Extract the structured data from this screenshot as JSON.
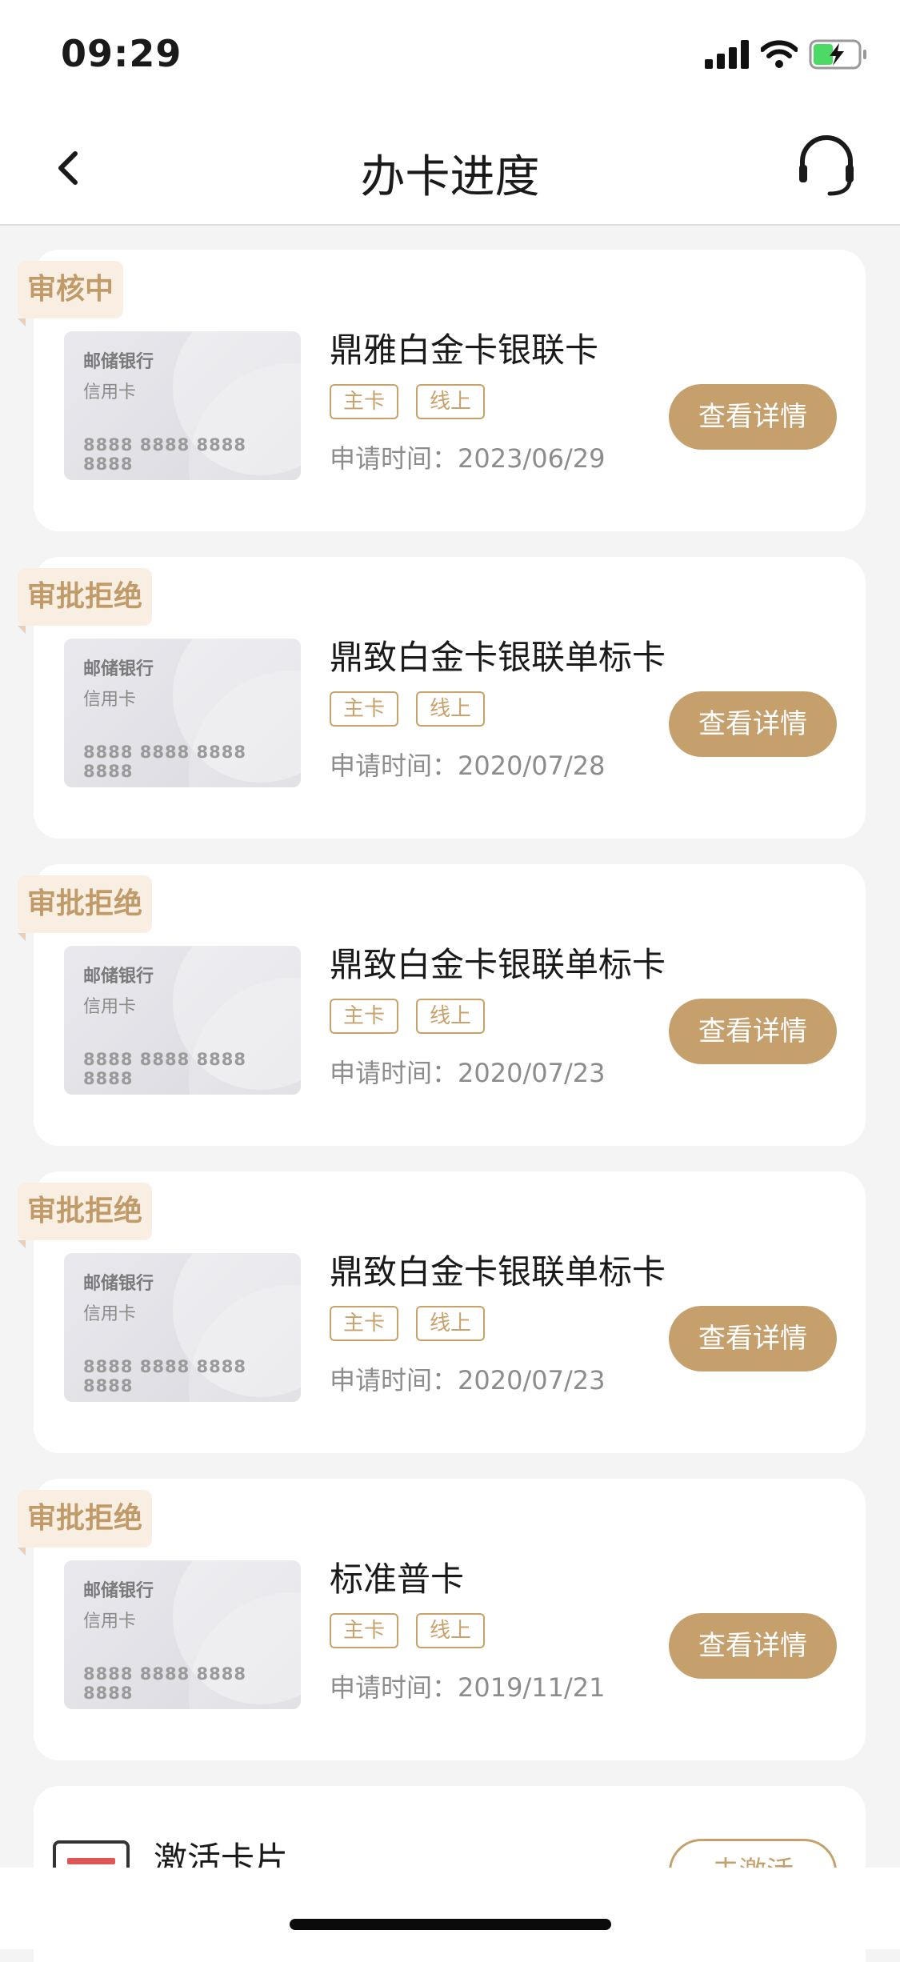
{
  "status_bar": {
    "time": "09:29"
  },
  "nav": {
    "title": "办卡进度"
  },
  "applications": [
    {
      "status": "审核中",
      "bank": "邮储银行",
      "card_type": "信用卡",
      "card_number": "8888 8888 8888 8888",
      "name": "鼎雅白金卡银联卡",
      "tags": [
        "主卡",
        "线上"
      ],
      "date": "申请时间：2023/06/29",
      "button": "查看详情"
    },
    {
      "status": "审批拒绝",
      "bank": "邮储银行",
      "card_type": "信用卡",
      "card_number": "8888 8888 8888 8888",
      "name": "鼎致白金卡银联单标卡",
      "tags": [
        "主卡",
        "线上"
      ],
      "date": "申请时间：2020/07/28",
      "button": "查看详情"
    },
    {
      "status": "审批拒绝",
      "bank": "邮储银行",
      "card_type": "信用卡",
      "card_number": "8888 8888 8888 8888",
      "name": "鼎致白金卡银联单标卡",
      "tags": [
        "主卡",
        "线上"
      ],
      "date": "申请时间：2020/07/23",
      "button": "查看详情"
    },
    {
      "status": "审批拒绝",
      "bank": "邮储银行",
      "card_type": "信用卡",
      "card_number": "8888 8888 8888 8888",
      "name": "鼎致白金卡银联单标卡",
      "tags": [
        "主卡",
        "线上"
      ],
      "date": "申请时间：2020/07/23",
      "button": "查看详情"
    },
    {
      "status": "审批拒绝",
      "bank": "邮储银行",
      "card_type": "信用卡",
      "card_number": "8888 8888 8888 8888",
      "name": "标准普卡",
      "tags": [
        "主卡",
        "线上"
      ],
      "date": "申请时间：2019/11/21",
      "button": "查看详情"
    }
  ],
  "activate": {
    "label": "激活卡片",
    "button": "去激活"
  },
  "icons": {
    "back": "chevron-left-icon",
    "service": "headset-icon",
    "signal": "signal-icon",
    "wifi": "wifi-icon",
    "battery": "battery-charging-icon",
    "activate": "card-icon"
  },
  "colors": {
    "accent": "#c5a06c",
    "tag_bg": "#f8eee2",
    "battery": "#4cd964",
    "activate_icon": "#e05656"
  }
}
